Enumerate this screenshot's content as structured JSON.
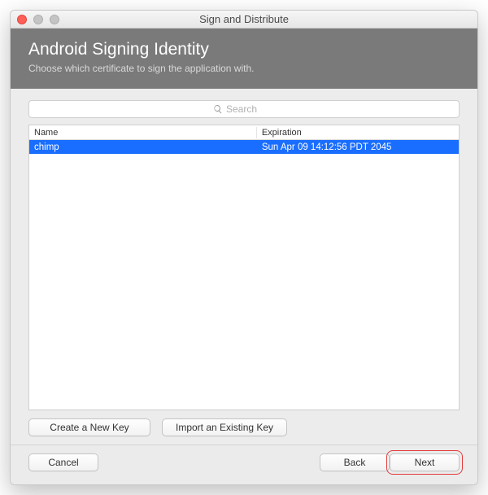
{
  "window": {
    "title": "Sign and Distribute"
  },
  "header": {
    "title": "Android Signing Identity",
    "subtitle": "Choose which certificate to sign the application with."
  },
  "search": {
    "placeholder": "Search"
  },
  "table": {
    "columns": {
      "name": "Name",
      "expiration": "Expiration"
    },
    "rows": [
      {
        "name": "chimp",
        "expiration": "Sun Apr 09 14:12:56 PDT 2045",
        "selected": true
      }
    ]
  },
  "key_actions": {
    "create": "Create a New Key",
    "import": "Import an Existing Key"
  },
  "footer": {
    "cancel": "Cancel",
    "back": "Back",
    "next": "Next"
  }
}
